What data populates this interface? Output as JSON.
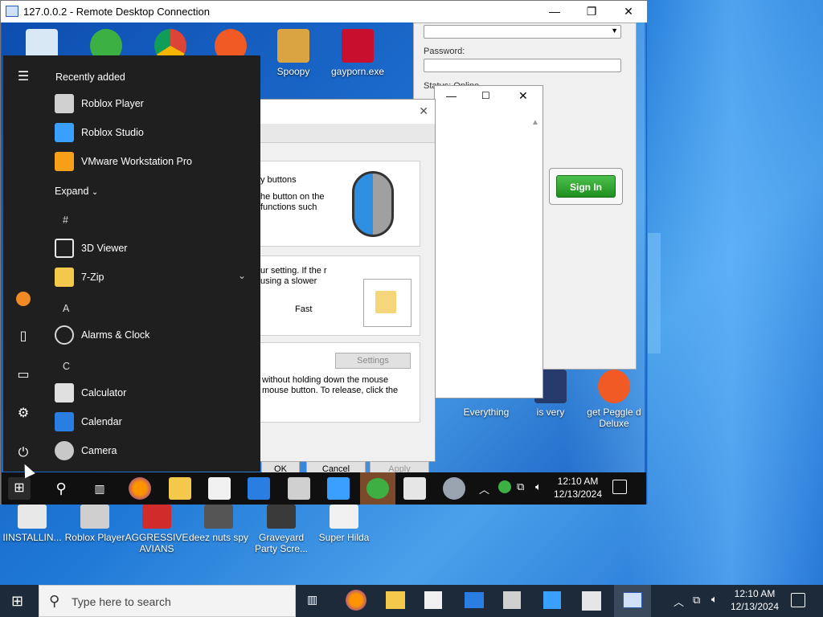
{
  "rdp": {
    "title": "127.0.0.2 - Remote Desktop Connection",
    "minimize": "—",
    "maximize": "❐",
    "close": "✕"
  },
  "remote_desktop_icons": [
    {
      "label": "Spoopy",
      "color": "#d9a441"
    },
    {
      "label": "gayporn.exe",
      "color": "#c8102e"
    },
    {
      "label": "Everything",
      "color": "#3b5998"
    },
    {
      "label": "is very",
      "color": "#263a6b"
    },
    {
      "label": "get Peggle d Deluxe",
      "color": "#f15a24"
    }
  ],
  "login_panel": {
    "password_label": "Password:",
    "status_label": "Status: Online",
    "sign_in": "Sign In"
  },
  "mouse_dialog": {
    "buttons_text": "y buttons",
    "buttons_desc": "he button on the functions such",
    "speed_desc": "ur setting. If the r using a slower",
    "fast": "Fast",
    "settings": "Settings",
    "clicklock_desc": "without holding down the mouse mouse button. To release, click the",
    "ok": "OK",
    "cancel": "Cancel",
    "apply": "Apply"
  },
  "start_menu": {
    "recently_added": "Recently added",
    "recent": [
      {
        "label": "Roblox Player",
        "color": "#d0d0d0"
      },
      {
        "label": "Roblox Studio",
        "color": "#3aa0ff"
      },
      {
        "label": "VMware Workstation Pro",
        "color": "#f6a01a"
      }
    ],
    "expand": "Expand",
    "sections": [
      {
        "letter": "#",
        "items": [
          {
            "label": "3D Viewer",
            "color": "#e8e8e8"
          },
          {
            "label": "7-Zip",
            "color": "#f3c84b"
          }
        ]
      },
      {
        "letter": "A",
        "items": [
          {
            "label": "Alarms & Clock",
            "color": "#d8d8d8"
          }
        ]
      },
      {
        "letter": "C",
        "items": [
          {
            "label": "Calculator",
            "color": "#e0e0e0"
          },
          {
            "label": "Calendar",
            "color": "#2a7de1"
          },
          {
            "label": "Camera",
            "color": "#c8c8c8"
          }
        ]
      }
    ]
  },
  "remote_taskbar": {
    "time": "12:10 AM",
    "date": "12/13/2024"
  },
  "host_icons": [
    {
      "label": "IINSTALLIN...",
      "color": "#e8e8e8"
    },
    {
      "label": "Roblox Player",
      "color": "#cfcfcf"
    },
    {
      "label": "AGGRESSIVE AVIANS",
      "color": "#d22b2b"
    },
    {
      "label": "deez nuts spy",
      "color": "#555555"
    },
    {
      "label": "Graveyard Party Scre...",
      "color": "#3a3a3a"
    },
    {
      "label": "Super Hilda",
      "color": "#f0f0f0"
    }
  ],
  "host_taskbar": {
    "search_placeholder": "Type here to search",
    "time": "12:10 AM",
    "date": "12/13/2024"
  }
}
